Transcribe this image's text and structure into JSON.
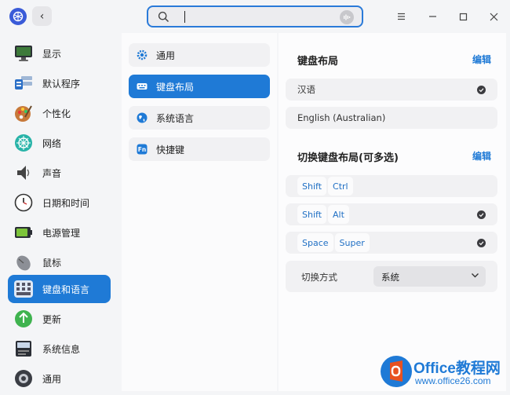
{
  "search": {
    "placeholder": "",
    "value": ""
  },
  "sidebar": {
    "items": [
      {
        "label": "显示",
        "icon": "display-icon"
      },
      {
        "label": "默认程序",
        "icon": "default-apps-icon"
      },
      {
        "label": "个性化",
        "icon": "personalization-icon"
      },
      {
        "label": "网络",
        "icon": "network-icon"
      },
      {
        "label": "声音",
        "icon": "sound-icon"
      },
      {
        "label": "日期和时间",
        "icon": "clock-icon"
      },
      {
        "label": "电源管理",
        "icon": "battery-icon"
      },
      {
        "label": "鼠标",
        "icon": "mouse-icon"
      },
      {
        "label": "键盘和语言",
        "icon": "keyboard-icon"
      },
      {
        "label": "更新",
        "icon": "update-icon"
      },
      {
        "label": "系统信息",
        "icon": "system-info-icon"
      },
      {
        "label": "通用",
        "icon": "general-icon"
      }
    ],
    "active_index": 8
  },
  "submenu": {
    "items": [
      {
        "label": "通用",
        "icon": "gear-icon"
      },
      {
        "label": "键盘布局",
        "icon": "keyboard-layout-icon"
      },
      {
        "label": "系统语言",
        "icon": "globe-icon"
      },
      {
        "label": "快捷键",
        "icon": "fn-key-icon"
      }
    ],
    "active_index": 1
  },
  "layout_section": {
    "title": "键盘布局",
    "edit_label": "编辑",
    "rows": [
      {
        "label": "汉语",
        "checked": true
      },
      {
        "label": "English (Australian)",
        "checked": false
      }
    ]
  },
  "switch_section": {
    "title": "切换键盘布局(可多选)",
    "edit_label": "编辑",
    "combos": [
      {
        "keys": [
          "Shift",
          "Ctrl"
        ],
        "checked": false
      },
      {
        "keys": [
          "Shift",
          "Alt"
        ],
        "checked": true
      },
      {
        "keys": [
          "Space",
          "Super"
        ],
        "checked": true
      }
    ],
    "method_label": "切换方式",
    "method_value": "系统"
  },
  "watermark": {
    "title": "Office教程网",
    "url": "www.office26.com"
  },
  "colors": {
    "accent": "#1f7ad6",
    "background": "#f4f5f7"
  }
}
